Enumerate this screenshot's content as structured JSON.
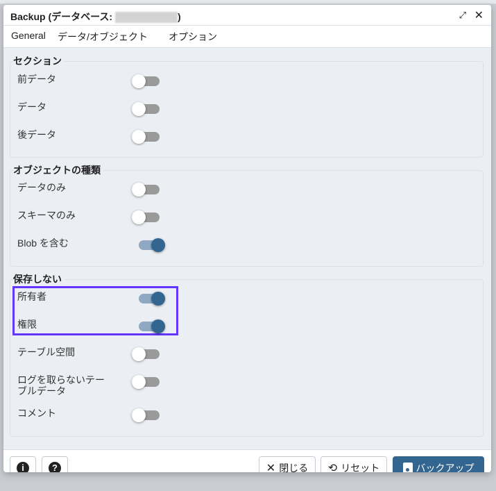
{
  "dialog": {
    "title_prefix": "Backup (データベース: ",
    "title_suffix": ")"
  },
  "tabs": [
    {
      "label": "General"
    },
    {
      "label": "データ/オブジェクト",
      "active": true
    },
    {
      "label": "オプション"
    }
  ],
  "sections": {
    "section": {
      "legend": "セクション",
      "items": [
        {
          "label": "前データ",
          "on": false
        },
        {
          "label": "データ",
          "on": false
        },
        {
          "label": "後データ",
          "on": false
        }
      ]
    },
    "object_types": {
      "legend": "オブジェクトの種類",
      "items": [
        {
          "label": "データのみ",
          "on": false
        },
        {
          "label": "スキーマのみ",
          "on": false
        },
        {
          "label": "Blob を含む",
          "on": true
        }
      ]
    },
    "do_not_save": {
      "legend": "保存しない",
      "items": [
        {
          "label": "所有者",
          "on": true
        },
        {
          "label": "権限",
          "on": true
        },
        {
          "label": "テーブル空間",
          "on": false
        },
        {
          "label": "ログを取らないテーブルデータ",
          "line1": "ログを取らないテー",
          "line2": "ブルデータ",
          "on": false
        },
        {
          "label": "コメント",
          "on": false
        }
      ]
    }
  },
  "footer": {
    "info_icon": "i",
    "help_icon": "?",
    "close_label": "閉じる",
    "reset_label": "リセット",
    "backup_label": "バックアップ"
  },
  "colors": {
    "accent": "#326690",
    "highlight": "#6236ff"
  }
}
